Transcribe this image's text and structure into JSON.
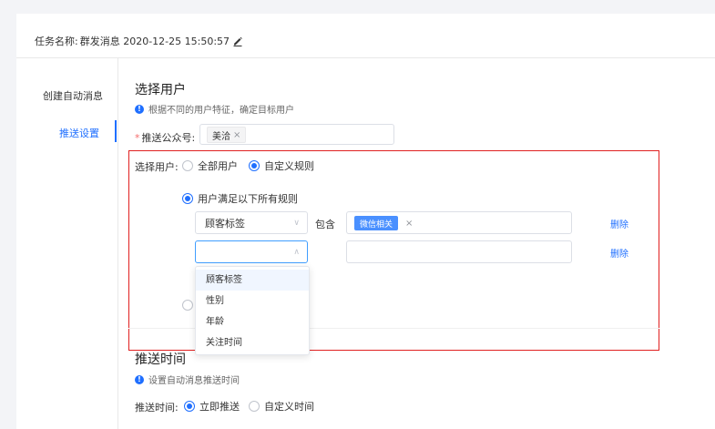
{
  "task": {
    "label": "任务名称:",
    "value": "群发消息 2020-12-25 15:50:57"
  },
  "sidebar": {
    "items": [
      {
        "label": "创建自动消息"
      },
      {
        "label": "推送设置"
      }
    ]
  },
  "select_users": {
    "title": "选择用户",
    "hint": "根据不同的用户特征，确定目标用户",
    "account_label": "推送公众号:",
    "account_tag": "美洽",
    "users_label": "选择用户:",
    "opt_all": "全部用户",
    "opt_custom": "自定义规则",
    "rule_mode": "用户满足以下所有规则",
    "rule1": {
      "field": "顾客标签",
      "op": "包含",
      "tag": "微信相关",
      "delete": "删除"
    },
    "rule2": {
      "field": "",
      "delete": "删除"
    },
    "dropdown": [
      "顾客标签",
      "性别",
      "年龄",
      "关注时间"
    ]
  },
  "push_time": {
    "title": "推送时间",
    "hint": "设置自动消息推送时间",
    "label": "推送时间:",
    "opt_now": "立即推送",
    "opt_custom": "自定义时间"
  },
  "colors": {
    "accent": "#1f6fff",
    "highlight_frame": "#e02020"
  }
}
